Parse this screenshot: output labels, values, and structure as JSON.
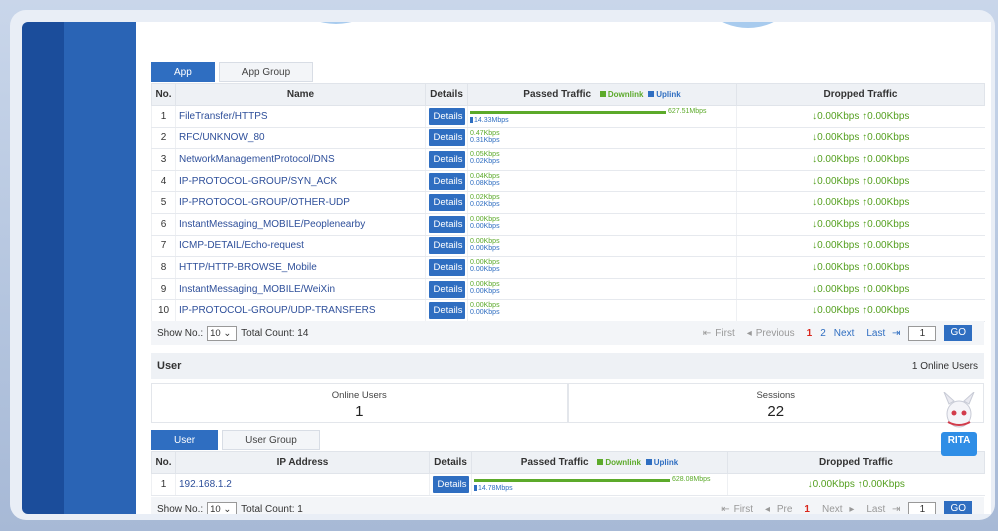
{
  "app_tabs": [
    "App",
    "App Group"
  ],
  "app_table": {
    "headers": {
      "no": "No.",
      "name": "Name",
      "details": "Details",
      "passed": "Passed Traffic",
      "downlink": "Downlink",
      "uplink": "Uplink",
      "dropped": "Dropped Traffic"
    },
    "rows": [
      {
        "no": "1",
        "name": "FileTransfer/HTTPS",
        "details": "Details",
        "down": "627.51Mbps",
        "up": "14.33Mbps",
        "down_frac": 1.0,
        "dropped": "↓0.00Kbps  ↑0.00Kbps"
      },
      {
        "no": "2",
        "name": "RFC/UNKNOW_80",
        "details": "Details",
        "down": "0.47Kbps",
        "up": "0.31Kbps",
        "down_frac": 0,
        "dropped": "↓0.00Kbps  ↑0.00Kbps"
      },
      {
        "no": "3",
        "name": "NetworkManagementProtocol/DNS",
        "details": "Details",
        "down": "0.05Kbps",
        "up": "0.02Kbps",
        "down_frac": 0,
        "dropped": "↓0.00Kbps  ↑0.00Kbps"
      },
      {
        "no": "4",
        "name": "IP-PROTOCOL-GROUP/SYN_ACK",
        "details": "Details",
        "down": "0.04Kbps",
        "up": "0.08Kbps",
        "down_frac": 0,
        "dropped": "↓0.00Kbps  ↑0.00Kbps"
      },
      {
        "no": "5",
        "name": "IP-PROTOCOL-GROUP/OTHER-UDP",
        "details": "Details",
        "down": "0.02Kbps",
        "up": "0.02Kbps",
        "down_frac": 0,
        "dropped": "↓0.00Kbps  ↑0.00Kbps"
      },
      {
        "no": "6",
        "name": "InstantMessaging_MOBILE/Peoplenearby",
        "details": "Details",
        "down": "0.00Kbps",
        "up": "0.00Kbps",
        "down_frac": 0,
        "dropped": "↓0.00Kbps  ↑0.00Kbps"
      },
      {
        "no": "7",
        "name": "ICMP-DETAIL/Echo-request",
        "details": "Details",
        "down": "0.00Kbps",
        "up": "0.00Kbps",
        "down_frac": 0,
        "dropped": "↓0.00Kbps  ↑0.00Kbps"
      },
      {
        "no": "8",
        "name": "HTTP/HTTP-BROWSE_Mobile",
        "details": "Details",
        "down": "0.00Kbps",
        "up": "0.00Kbps",
        "down_frac": 0,
        "dropped": "↓0.00Kbps  ↑0.00Kbps"
      },
      {
        "no": "9",
        "name": "InstantMessaging_MOBILE/WeiXin",
        "details": "Details",
        "down": "0.00Kbps",
        "up": "0.00Kbps",
        "down_frac": 0,
        "dropped": "↓0.00Kbps  ↑0.00Kbps"
      },
      {
        "no": "10",
        "name": "IP-PROTOCOL-GROUP/UDP-TRANSFERS",
        "details": "Details",
        "down": "0.00Kbps",
        "up": "0.00Kbps",
        "down_frac": 0,
        "dropped": "↓0.00Kbps  ↑0.00Kbps"
      }
    ]
  },
  "app_footer": {
    "show_no": "Show No.:",
    "show_value": "10",
    "total": "Total Count: 14",
    "first": "First",
    "previous": "Previous",
    "page1": "1",
    "page2": "2",
    "next": "Next",
    "last": "Last",
    "page_input": "1",
    "go": "GO"
  },
  "user_section": {
    "title": "User",
    "online_count": "1 Online Users",
    "online_users_label": "Online Users",
    "online_users_value": "1",
    "sessions_label": "Sessions",
    "sessions_value": "22"
  },
  "user_tabs": [
    "User",
    "User Group"
  ],
  "user_table": {
    "headers": {
      "no": "No.",
      "ip": "IP Address",
      "details": "Details",
      "passed": "Passed Traffic",
      "downlink": "Downlink",
      "uplink": "Uplink",
      "dropped": "Dropped Traffic"
    },
    "rows": [
      {
        "no": "1",
        "ip": "192.168.1.2",
        "details": "Details",
        "down": "628.08Mbps",
        "up": "14.78Mbps",
        "down_frac": 1.0,
        "dropped": "↓0.00Kbps  ↑0.00Kbps"
      }
    ]
  },
  "user_footer": {
    "show_no": "Show No.:",
    "show_value": "10",
    "total": "Total Count: 1",
    "first": "First",
    "pre": "Pre",
    "page1": "1",
    "next": "Next",
    "last": "Last",
    "page_input": "1",
    "go": "GO"
  },
  "mascot_label": "RITA",
  "colors": {
    "accent": "#2f6ec1",
    "downlink": "#5caa2a",
    "sidebar": "#1b4d9b",
    "current_page": "#d9261c"
  }
}
